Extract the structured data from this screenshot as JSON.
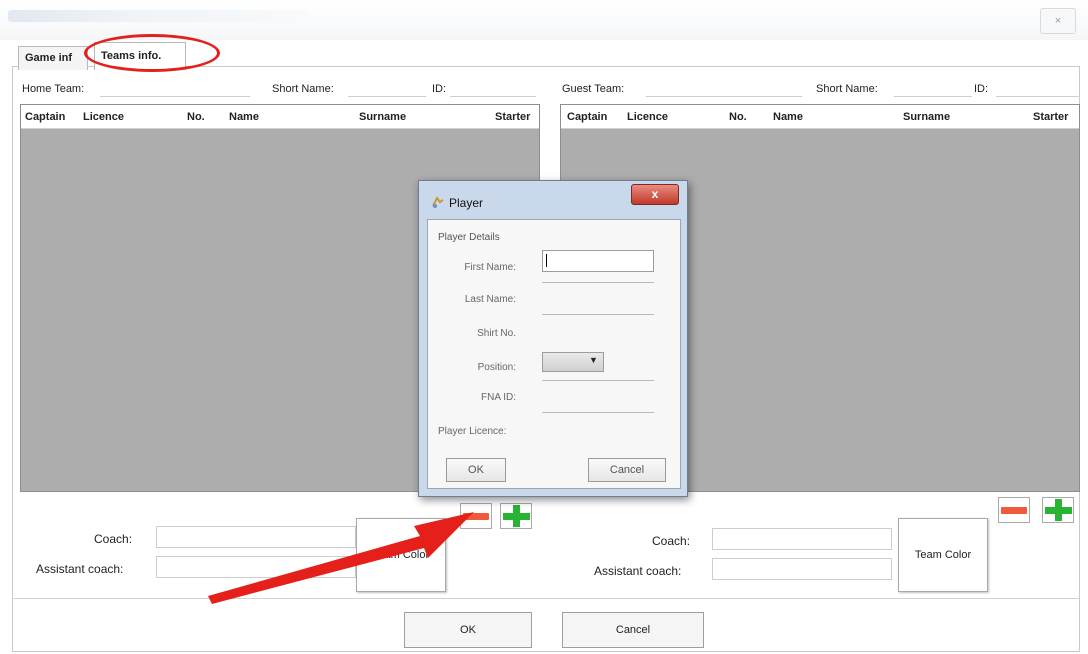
{
  "window": {
    "close_glyph": "×"
  },
  "tabs": [
    {
      "label": "Game inf"
    },
    {
      "label": "Teams info."
    }
  ],
  "home": {
    "team_label": "Home Team:",
    "short_name_label": "Short Name:",
    "id_label": "ID:",
    "columns": [
      "Captain",
      "Licence",
      "No.",
      "Name",
      "Surname",
      "Starter"
    ],
    "coach_label": "Coach:",
    "assistant_label": "Assistant coach:",
    "team_color_label": "Team Color"
  },
  "guest": {
    "team_label": "Guest Team:",
    "short_name_label": "Short Name:",
    "id_label": "ID:",
    "columns": [
      "Captain",
      "Licence",
      "No.",
      "Name",
      "Surname",
      "Starter"
    ],
    "coach_label": "Coach:",
    "assistant_label": "Assistant coach:",
    "team_color_label": "Team Color"
  },
  "buttons": {
    "ok": "OK",
    "cancel": "Cancel"
  },
  "dialog": {
    "title": "Player",
    "close_glyph": "x",
    "section": "Player Details",
    "first_name_label": "First Name:",
    "first_name_value": "",
    "last_name_label": "Last Name:",
    "shirt_label": "Shirt No.",
    "position_label": "Position:",
    "fna_label": "FNA ID:",
    "licence_label": "Player Licence:",
    "ok": "OK",
    "cancel": "Cancel"
  },
  "colors": {
    "highlight": "#e2211c",
    "grid": "#adadad",
    "minus": "#f05a3c",
    "plus": "#29b334"
  },
  "icons": [
    "close-icon",
    "player-icon",
    "minus-icon",
    "plus-icon",
    "dropdown-arrow-icon",
    "annotation-arrow-icon"
  ]
}
